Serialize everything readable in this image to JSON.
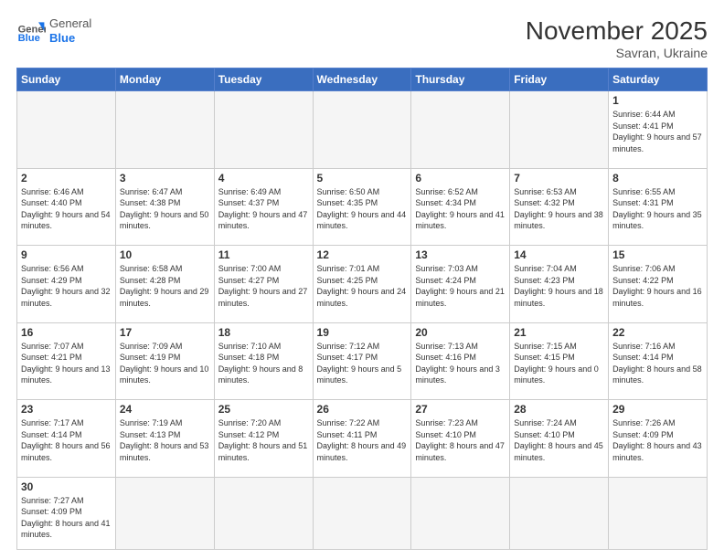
{
  "header": {
    "logo_general": "General",
    "logo_blue": "Blue",
    "month_title": "November 2025",
    "location": "Savran, Ukraine"
  },
  "weekdays": [
    "Sunday",
    "Monday",
    "Tuesday",
    "Wednesday",
    "Thursday",
    "Friday",
    "Saturday"
  ],
  "weeks": [
    [
      {
        "day": "",
        "info": "",
        "empty": true
      },
      {
        "day": "",
        "info": "",
        "empty": true
      },
      {
        "day": "",
        "info": "",
        "empty": true
      },
      {
        "day": "",
        "info": "",
        "empty": true
      },
      {
        "day": "",
        "info": "",
        "empty": true
      },
      {
        "day": "",
        "info": "",
        "empty": true
      },
      {
        "day": "1",
        "info": "Sunrise: 6:44 AM\nSunset: 4:41 PM\nDaylight: 9 hours\nand 57 minutes."
      }
    ],
    [
      {
        "day": "2",
        "info": "Sunrise: 6:46 AM\nSunset: 4:40 PM\nDaylight: 9 hours\nand 54 minutes."
      },
      {
        "day": "3",
        "info": "Sunrise: 6:47 AM\nSunset: 4:38 PM\nDaylight: 9 hours\nand 50 minutes."
      },
      {
        "day": "4",
        "info": "Sunrise: 6:49 AM\nSunset: 4:37 PM\nDaylight: 9 hours\nand 47 minutes."
      },
      {
        "day": "5",
        "info": "Sunrise: 6:50 AM\nSunset: 4:35 PM\nDaylight: 9 hours\nand 44 minutes."
      },
      {
        "day": "6",
        "info": "Sunrise: 6:52 AM\nSunset: 4:34 PM\nDaylight: 9 hours\nand 41 minutes."
      },
      {
        "day": "7",
        "info": "Sunrise: 6:53 AM\nSunset: 4:32 PM\nDaylight: 9 hours\nand 38 minutes."
      },
      {
        "day": "8",
        "info": "Sunrise: 6:55 AM\nSunset: 4:31 PM\nDaylight: 9 hours\nand 35 minutes."
      }
    ],
    [
      {
        "day": "9",
        "info": "Sunrise: 6:56 AM\nSunset: 4:29 PM\nDaylight: 9 hours\nand 32 minutes."
      },
      {
        "day": "10",
        "info": "Sunrise: 6:58 AM\nSunset: 4:28 PM\nDaylight: 9 hours\nand 29 minutes."
      },
      {
        "day": "11",
        "info": "Sunrise: 7:00 AM\nSunset: 4:27 PM\nDaylight: 9 hours\nand 27 minutes."
      },
      {
        "day": "12",
        "info": "Sunrise: 7:01 AM\nSunset: 4:25 PM\nDaylight: 9 hours\nand 24 minutes."
      },
      {
        "day": "13",
        "info": "Sunrise: 7:03 AM\nSunset: 4:24 PM\nDaylight: 9 hours\nand 21 minutes."
      },
      {
        "day": "14",
        "info": "Sunrise: 7:04 AM\nSunset: 4:23 PM\nDaylight: 9 hours\nand 18 minutes."
      },
      {
        "day": "15",
        "info": "Sunrise: 7:06 AM\nSunset: 4:22 PM\nDaylight: 9 hours\nand 16 minutes."
      }
    ],
    [
      {
        "day": "16",
        "info": "Sunrise: 7:07 AM\nSunset: 4:21 PM\nDaylight: 9 hours\nand 13 minutes."
      },
      {
        "day": "17",
        "info": "Sunrise: 7:09 AM\nSunset: 4:19 PM\nDaylight: 9 hours\nand 10 minutes."
      },
      {
        "day": "18",
        "info": "Sunrise: 7:10 AM\nSunset: 4:18 PM\nDaylight: 9 hours\nand 8 minutes."
      },
      {
        "day": "19",
        "info": "Sunrise: 7:12 AM\nSunset: 4:17 PM\nDaylight: 9 hours\nand 5 minutes."
      },
      {
        "day": "20",
        "info": "Sunrise: 7:13 AM\nSunset: 4:16 PM\nDaylight: 9 hours\nand 3 minutes."
      },
      {
        "day": "21",
        "info": "Sunrise: 7:15 AM\nSunset: 4:15 PM\nDaylight: 9 hours\nand 0 minutes."
      },
      {
        "day": "22",
        "info": "Sunrise: 7:16 AM\nSunset: 4:14 PM\nDaylight: 8 hours\nand 58 minutes."
      }
    ],
    [
      {
        "day": "23",
        "info": "Sunrise: 7:17 AM\nSunset: 4:14 PM\nDaylight: 8 hours\nand 56 minutes."
      },
      {
        "day": "24",
        "info": "Sunrise: 7:19 AM\nSunset: 4:13 PM\nDaylight: 8 hours\nand 53 minutes."
      },
      {
        "day": "25",
        "info": "Sunrise: 7:20 AM\nSunset: 4:12 PM\nDaylight: 8 hours\nand 51 minutes."
      },
      {
        "day": "26",
        "info": "Sunrise: 7:22 AM\nSunset: 4:11 PM\nDaylight: 8 hours\nand 49 minutes."
      },
      {
        "day": "27",
        "info": "Sunrise: 7:23 AM\nSunset: 4:10 PM\nDaylight: 8 hours\nand 47 minutes."
      },
      {
        "day": "28",
        "info": "Sunrise: 7:24 AM\nSunset: 4:10 PM\nDaylight: 8 hours\nand 45 minutes."
      },
      {
        "day": "29",
        "info": "Sunrise: 7:26 AM\nSunset: 4:09 PM\nDaylight: 8 hours\nand 43 minutes."
      }
    ],
    [
      {
        "day": "30",
        "info": "Sunrise: 7:27 AM\nSunset: 4:09 PM\nDaylight: 8 hours\nand 41 minutes.",
        "last": true
      },
      {
        "day": "",
        "info": "",
        "empty": true,
        "last": true
      },
      {
        "day": "",
        "info": "",
        "empty": true,
        "last": true
      },
      {
        "day": "",
        "info": "",
        "empty": true,
        "last": true
      },
      {
        "day": "",
        "info": "",
        "empty": true,
        "last": true
      },
      {
        "day": "",
        "info": "",
        "empty": true,
        "last": true
      },
      {
        "day": "",
        "info": "",
        "empty": true,
        "last": true
      }
    ]
  ]
}
